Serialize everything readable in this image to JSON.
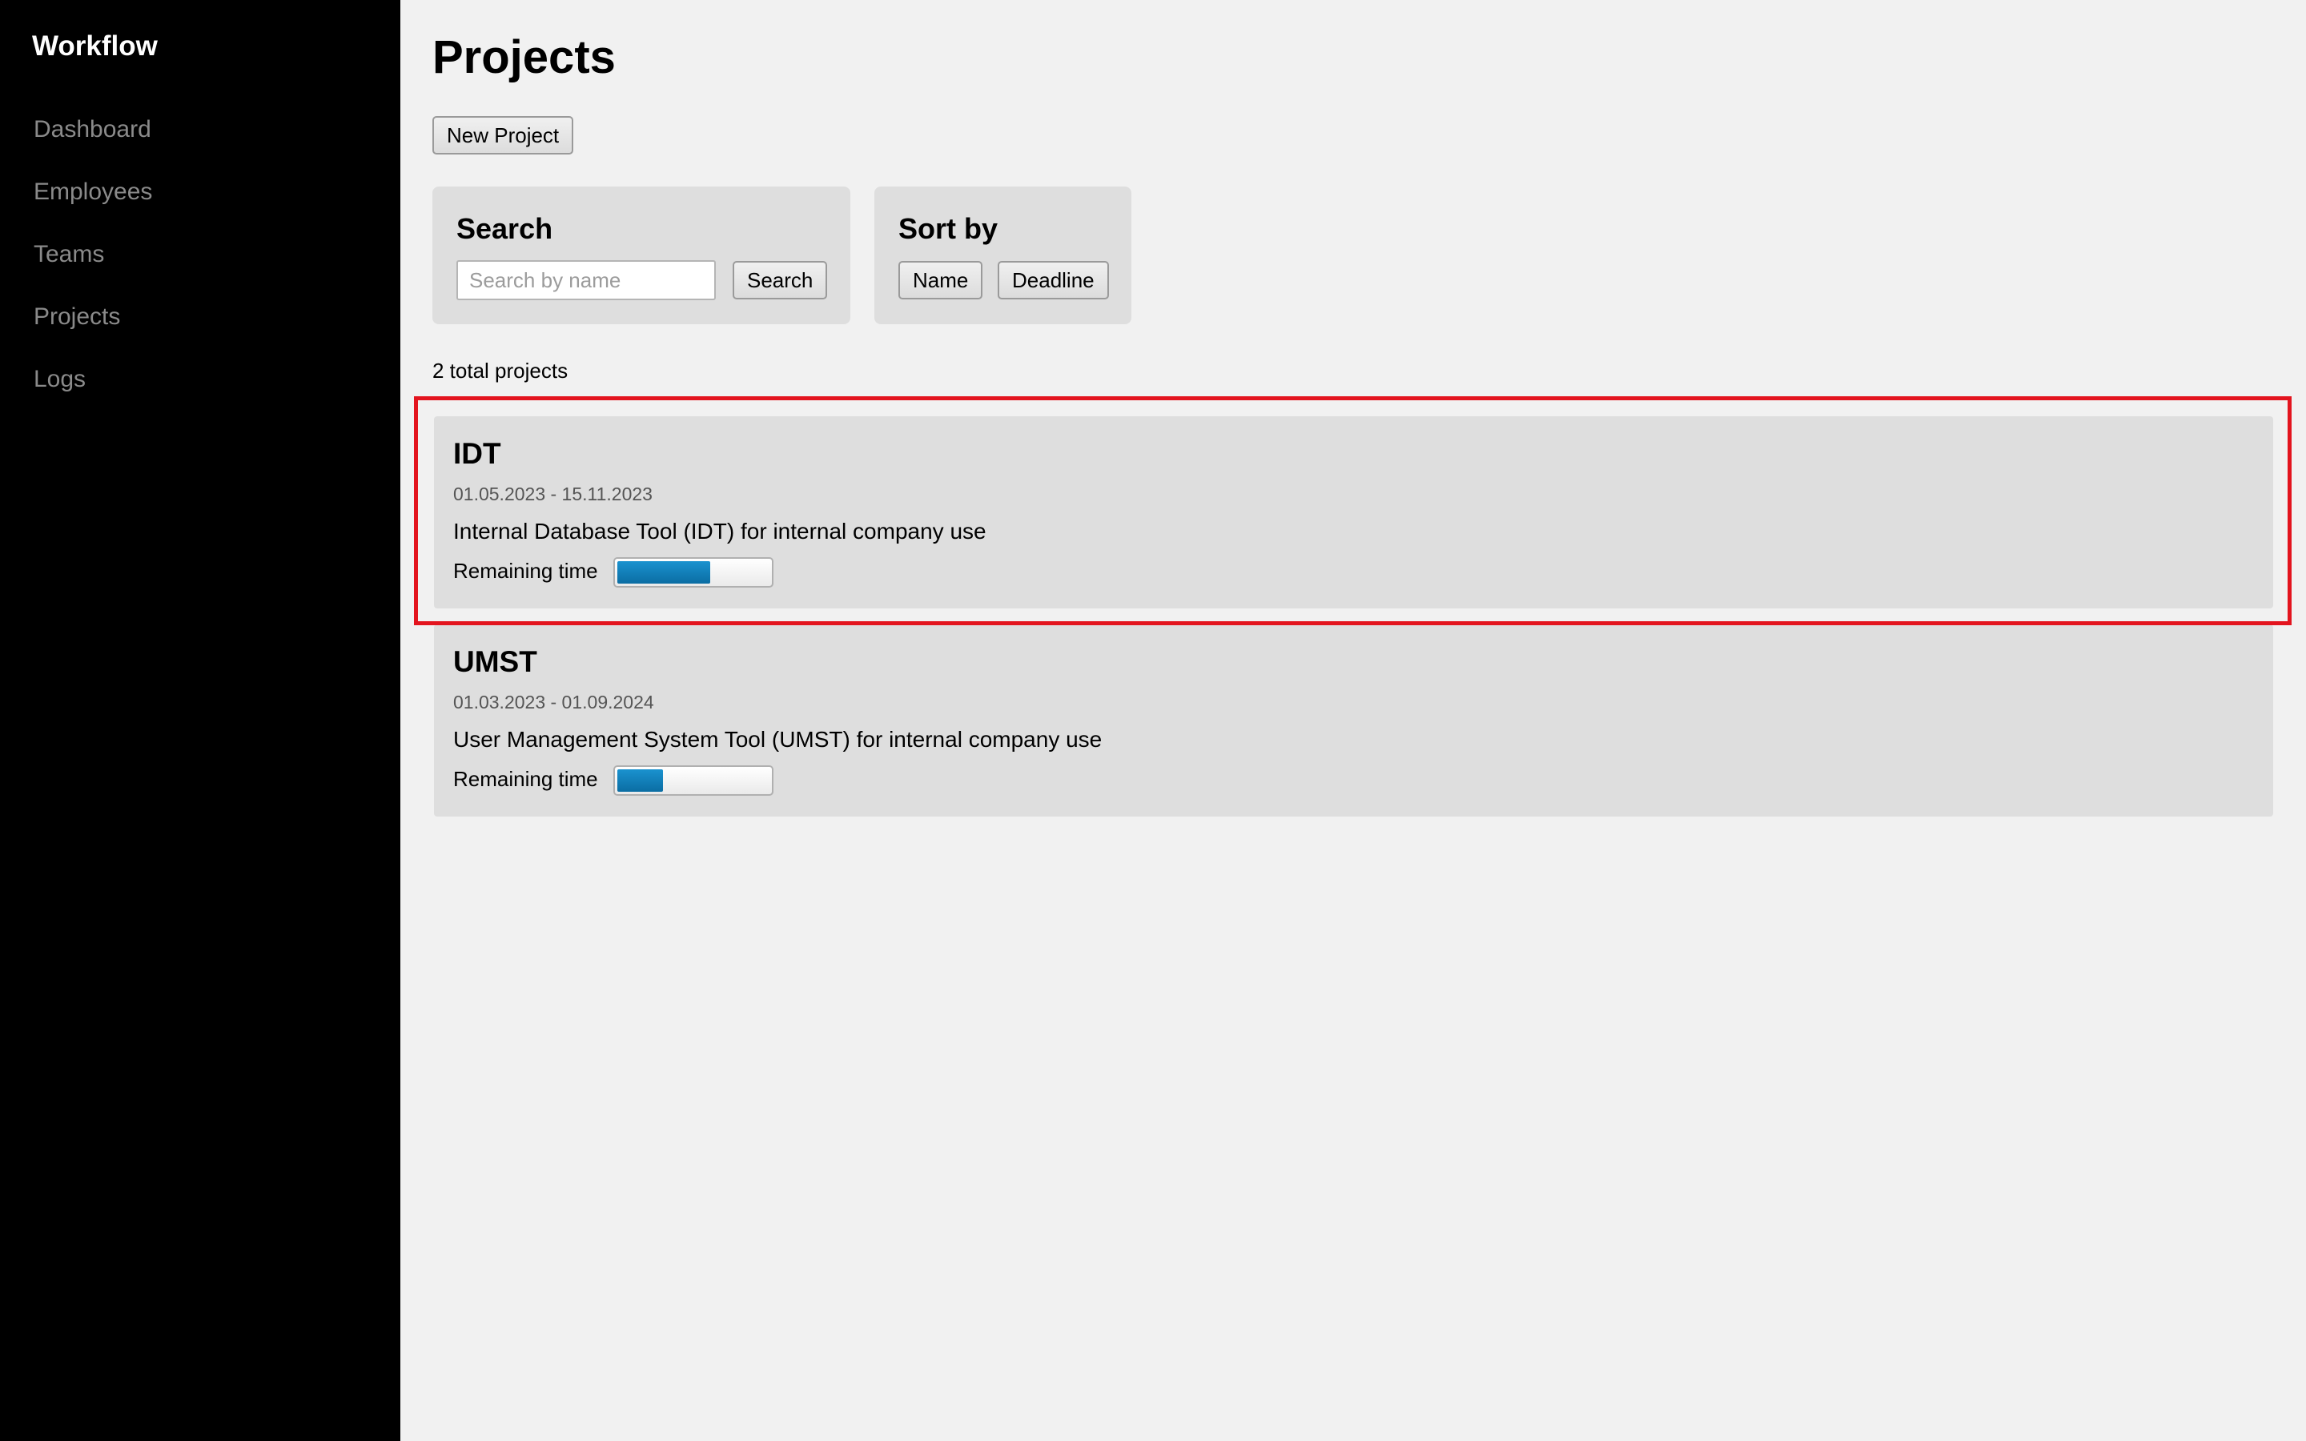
{
  "app": {
    "brand": "Workflow"
  },
  "sidebar": {
    "items": [
      {
        "label": "Dashboard"
      },
      {
        "label": "Employees"
      },
      {
        "label": "Teams"
      },
      {
        "label": "Projects"
      },
      {
        "label": "Logs"
      }
    ]
  },
  "page": {
    "title": "Projects",
    "new_project_label": "New Project",
    "total_label": "2 total projects"
  },
  "search": {
    "title": "Search",
    "placeholder": "Search by name",
    "value": "",
    "button_label": "Search"
  },
  "sort": {
    "title": "Sort by",
    "options": [
      {
        "label": "Name"
      },
      {
        "label": "Deadline"
      }
    ]
  },
  "projects": [
    {
      "name": "IDT",
      "dates": "01.05.2023 - 15.11.2023",
      "description": "Internal Database Tool (IDT) for internal company use",
      "remaining_label": "Remaining time",
      "remaining_fraction": 0.61,
      "highlighted": true
    },
    {
      "name": "UMST",
      "dates": "01.03.2023 - 01.09.2024",
      "description": "User Management System Tool (UMST) for internal company use",
      "remaining_label": "Remaining time",
      "remaining_fraction": 0.3
    }
  ],
  "colors": {
    "sidebar_bg": "#000000",
    "page_bg": "#f1f1f1",
    "panel_bg": "#dedede",
    "progress_fill": "#0b79b6",
    "highlight_border": "#e3141e"
  }
}
